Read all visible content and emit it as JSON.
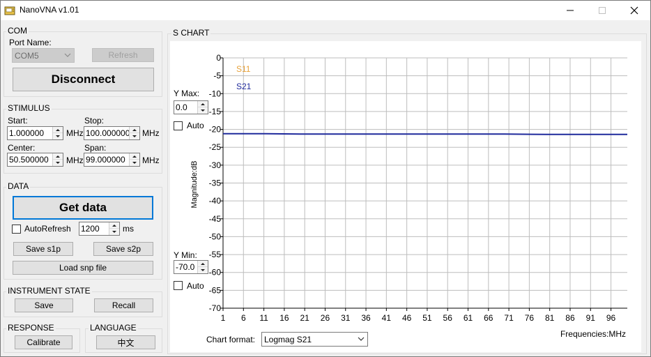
{
  "window": {
    "title": "NanoVNA v1.01",
    "icon": "nanovna-app-icon",
    "minimize_icon": "minimize-icon",
    "maximize_icon": "maximize-icon",
    "close_icon": "close-icon"
  },
  "com": {
    "group_label": "COM",
    "port_name_label": "Port Name:",
    "port_value": "COM5",
    "refresh_label": "Refresh",
    "disconnect_label": "Disconnect"
  },
  "stimulus": {
    "group_label": "STIMULUS",
    "start_label": "Start:",
    "start_value": "1.000000",
    "stop_label": "Stop:",
    "stop_value": "100.000000",
    "center_label": "Center:",
    "center_value": "50.500000",
    "span_label": "Span:",
    "span_value": "99.000000",
    "unit": "MHz"
  },
  "data": {
    "group_label": "DATA",
    "get_data_label": "Get data",
    "autorefresh_label": "AutoRefresh",
    "autorefresh_checked": false,
    "interval_value": "1200",
    "interval_unit": "ms",
    "save_s1p_label": "Save s1p",
    "save_s2p_label": "Save s2p",
    "load_snp_label": "Load snp file"
  },
  "instrument_state": {
    "group_label": "INSTRUMENT STATE",
    "save_label": "Save",
    "recall_label": "Recall"
  },
  "response": {
    "group_label": "RESPONSE",
    "calibrate_label": "Calibrate"
  },
  "language": {
    "group_label": "LANGUAGE",
    "button_label": "中文"
  },
  "chart_panel": {
    "group_label": "S CHART",
    "ymax_label": "Y Max:",
    "ymax_value": "0.0",
    "ymax_auto_label": "Auto",
    "ymin_label": "Y Min:",
    "ymin_value": "-70.0",
    "ymin_auto_label": "Auto",
    "format_label": "Chart format:",
    "format_value": "Logmag S21"
  },
  "colors": {
    "s11": "#e8a23a",
    "s21": "#1f2a9c",
    "grid": "#bdbdbd",
    "accent": "#0078d7"
  },
  "chart_data": {
    "type": "line",
    "xlabel": "Frequencies:MHz",
    "ylabel": "Magnitude:dB",
    "xlim": [
      1,
      100
    ],
    "ylim": [
      -70,
      0
    ],
    "x_ticks": [
      1,
      6,
      11,
      16,
      21,
      26,
      31,
      36,
      41,
      46,
      51,
      56,
      61,
      66,
      71,
      76,
      81,
      86,
      91,
      96
    ],
    "y_ticks": [
      0,
      -5,
      -10,
      -15,
      -20,
      -25,
      -30,
      -35,
      -40,
      -45,
      -50,
      -55,
      -60,
      -65,
      -70
    ],
    "grid": true,
    "legend_placement": "top-left",
    "series": [
      {
        "name": "S11",
        "color": "#e8a23a",
        "x": [],
        "y": []
      },
      {
        "name": "S21",
        "color": "#1f2a9c",
        "x": [
          1,
          10,
          20,
          30,
          40,
          50,
          60,
          70,
          80,
          90,
          100
        ],
        "y": [
          -21.2,
          -21.2,
          -21.3,
          -21.3,
          -21.3,
          -21.3,
          -21.3,
          -21.3,
          -21.4,
          -21.4,
          -21.4
        ]
      }
    ]
  }
}
